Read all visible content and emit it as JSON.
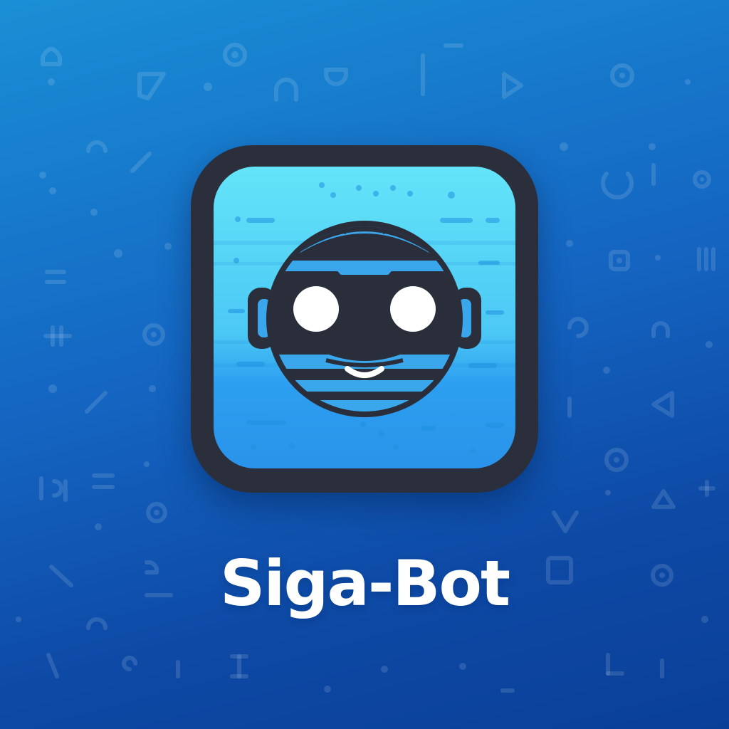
{
  "app": {
    "name": "Siga-Bot"
  },
  "logo": {
    "icon": "robot-face-icon",
    "colors": {
      "background_top": "#1a8fd6",
      "background_bottom": "#0a3f98",
      "frame": "#2b2f3c",
      "tile_top": "#5fe0f7",
      "tile_bottom": "#2a9cf0",
      "head_dark": "#2a2e3b",
      "band_blue": "#3aa6ec",
      "eye": "#ffffff"
    }
  },
  "background": {
    "pattern": "faint-tech-glyphs"
  }
}
